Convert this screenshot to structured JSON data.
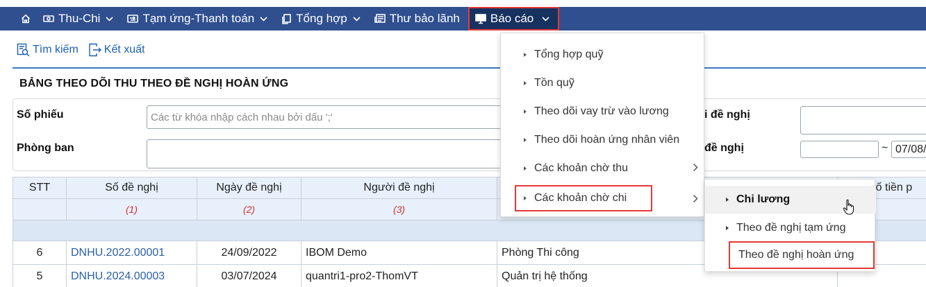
{
  "nav": {
    "thu_chi": "Thu-Chi",
    "tam_ung": "Tạm ứng-Thanh toán",
    "tong_hop": "Tổng hợp",
    "thu_bao_lanh": "Thư bảo lãnh",
    "bao_cao": "Báo cáo"
  },
  "toolbar": {
    "search": "Tìm kiếm",
    "export": "Kết xuất"
  },
  "page_title": "BẢNG THEO DÕI THU THEO ĐỀ NGHỊ HOÀN ỨNG",
  "filters": {
    "so_phieu_label": "Số phiếu",
    "so_phieu_placeholder": "Các từ khóa nhập cách nhau bởi dấu ';'",
    "phong_ban_label": "Phòng ban",
    "nguoi_de_nghi_label_partial": "i đề nghị",
    "ngay_de_nghi_label_partial": "đề nghị",
    "date_separator": "~",
    "date_to_value": "07/08/"
  },
  "table": {
    "headers": [
      "STT",
      "Số đề nghị",
      "Ngày đề nghị",
      "Người đề nghị",
      "",
      "Số tiền p"
    ],
    "index_labels": [
      "",
      "(1)",
      "(2)",
      "(3)",
      "",
      ""
    ],
    "rows": [
      {
        "stt": "6",
        "so_de_nghi": "DNHU.2022.00001",
        "ngay": "24/09/2022",
        "nguoi": "IBOM Demo",
        "phong_ban": "Phòng Thi công"
      },
      {
        "stt": "5",
        "so_de_nghi": "DNHU.2024.00003",
        "ngay": "03/07/2024",
        "nguoi": "quantri1-pro2-ThomVT",
        "phong_ban": "Quản trị hệ thống"
      }
    ]
  },
  "menu": {
    "items": [
      {
        "label": "Tổng hợp quỹ"
      },
      {
        "label": "Tồn quỹ"
      },
      {
        "label": "Theo dõi vay trừ vào lương"
      },
      {
        "label": "Theo dõi hoàn ứng nhân viên"
      },
      {
        "label": "Các khoản chờ thu"
      },
      {
        "label": "Các khoản chờ chi"
      }
    ]
  },
  "submenu": {
    "items": [
      {
        "label": "Chi lương"
      },
      {
        "label": "Theo đề nghị tạm ứng"
      },
      {
        "label": "Theo đề nghị hoàn ứng"
      }
    ]
  },
  "colors": {
    "navbar": "#2f4f8f",
    "highlight": "#e53935",
    "link": "#1a5fb4"
  }
}
